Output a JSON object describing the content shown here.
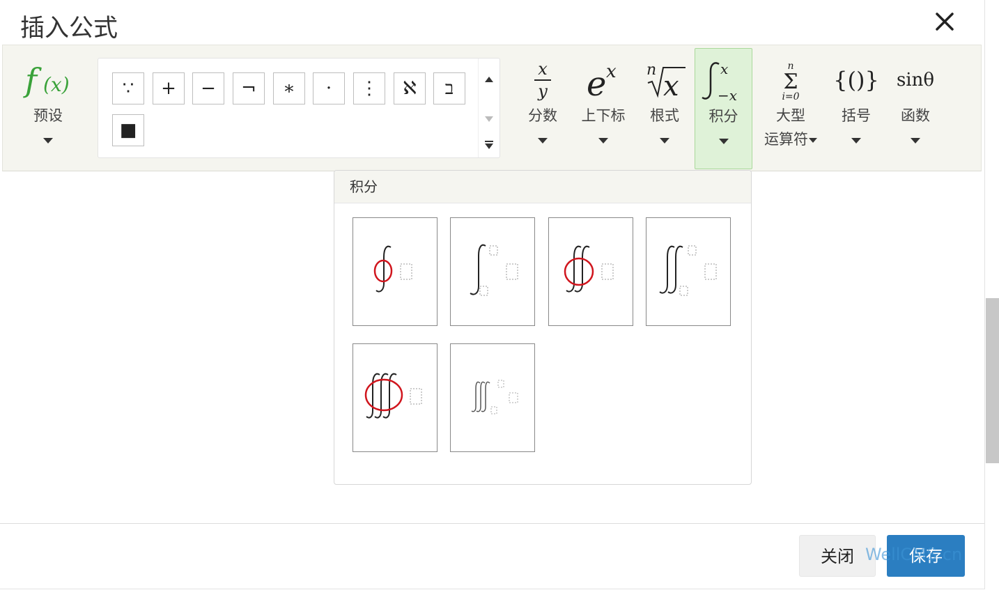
{
  "dialog": {
    "title": "插入公式"
  },
  "toolbar": {
    "preset": {
      "label": "预设"
    },
    "fraction": {
      "label": "分数"
    },
    "script": {
      "label": "上下标"
    },
    "radical": {
      "label": "根式"
    },
    "integral": {
      "label": "积分"
    },
    "large_operator": {
      "label_line1": "大型",
      "label_line2": "运算符"
    },
    "bracket": {
      "label": "括号",
      "icon_text": "{()}"
    },
    "function": {
      "label": "函数",
      "icon_text": "sinθ"
    }
  },
  "symbols": [
    "∵",
    "+",
    "−",
    "¬",
    "∗",
    "·",
    "⋮",
    "ℵ",
    "ב",
    "■"
  ],
  "integral_panel": {
    "title": "积分",
    "items": [
      "contour-integral",
      "definite-integral",
      "double-contour-integral",
      "double-integral-with-limits",
      "triple-contour-integral",
      "triple-integral-with-limits"
    ]
  },
  "footer": {
    "close_label": "关闭",
    "save_label": "保存"
  },
  "watermark": {
    "text": "WellCMS.cn"
  },
  "colors": {
    "save": "#2b7ec1",
    "active_tool": "#dff2d8",
    "preset_icon": "#3aa23a",
    "highlight_circle": "#d0151d"
  }
}
